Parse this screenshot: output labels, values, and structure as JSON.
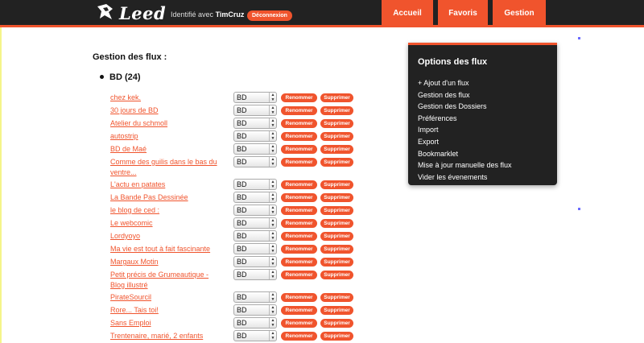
{
  "header": {
    "logo_text": "Leed",
    "identified_prefix": "Identifié avec",
    "username": "TimCruz",
    "logout_label": "Déconnexion",
    "nav": [
      {
        "label": "Accueil"
      },
      {
        "label": "Favoris"
      },
      {
        "label": "Gestion"
      }
    ]
  },
  "main": {
    "section_title": "Gestion des flux :",
    "folder_label": "BD (24)",
    "feeds": [
      {
        "name": "chez kek.",
        "folder": "BD"
      },
      {
        "name": "30 jours de BD",
        "folder": "BD"
      },
      {
        "name": "Atelier du schmoll",
        "folder": "BD"
      },
      {
        "name": "autostrip",
        "folder": "BD"
      },
      {
        "name": "BD de Maé",
        "folder": "BD"
      },
      {
        "name": "Comme des guilis dans le bas du ventre...",
        "folder": "BD"
      },
      {
        "name": "L'actu en patates",
        "folder": "BD"
      },
      {
        "name": "La Bande Pas Dessinée",
        "folder": "BD"
      },
      {
        "name": "le blog de ced :",
        "folder": "BD"
      },
      {
        "name": "Le webcomic",
        "folder": "BD"
      },
      {
        "name": "Lordyoyo",
        "folder": "BD"
      },
      {
        "name": "Ma vie est tout à fait fascinante",
        "folder": "BD"
      },
      {
        "name": "Margaux Motin",
        "folder": "BD"
      },
      {
        "name": "Petit précis de Grumeautique - Blog illustré",
        "folder": "BD"
      },
      {
        "name": "PirateSourcil",
        "folder": "BD"
      },
      {
        "name": "Rore... Tais toi!",
        "folder": "BD"
      },
      {
        "name": "Sans Emploi",
        "folder": "BD"
      },
      {
        "name": "Trentenaire, marié, 2 enfants",
        "folder": "BD"
      }
    ],
    "rename_label": "Renommer",
    "delete_label": "Supprimer"
  },
  "options": {
    "title": "Options des flux",
    "items": [
      "+ Ajout d'un flux",
      "Gestion des flux",
      "Gestion des Dossiers",
      "Préférences",
      "Import",
      "Export",
      "Bookmarklet",
      "Mise à jour manuelle des flux",
      "Vider les évenements"
    ]
  },
  "colors": {
    "accent": "#f0542d",
    "header_bg": "#222222",
    "panel_bg": "#222222"
  }
}
